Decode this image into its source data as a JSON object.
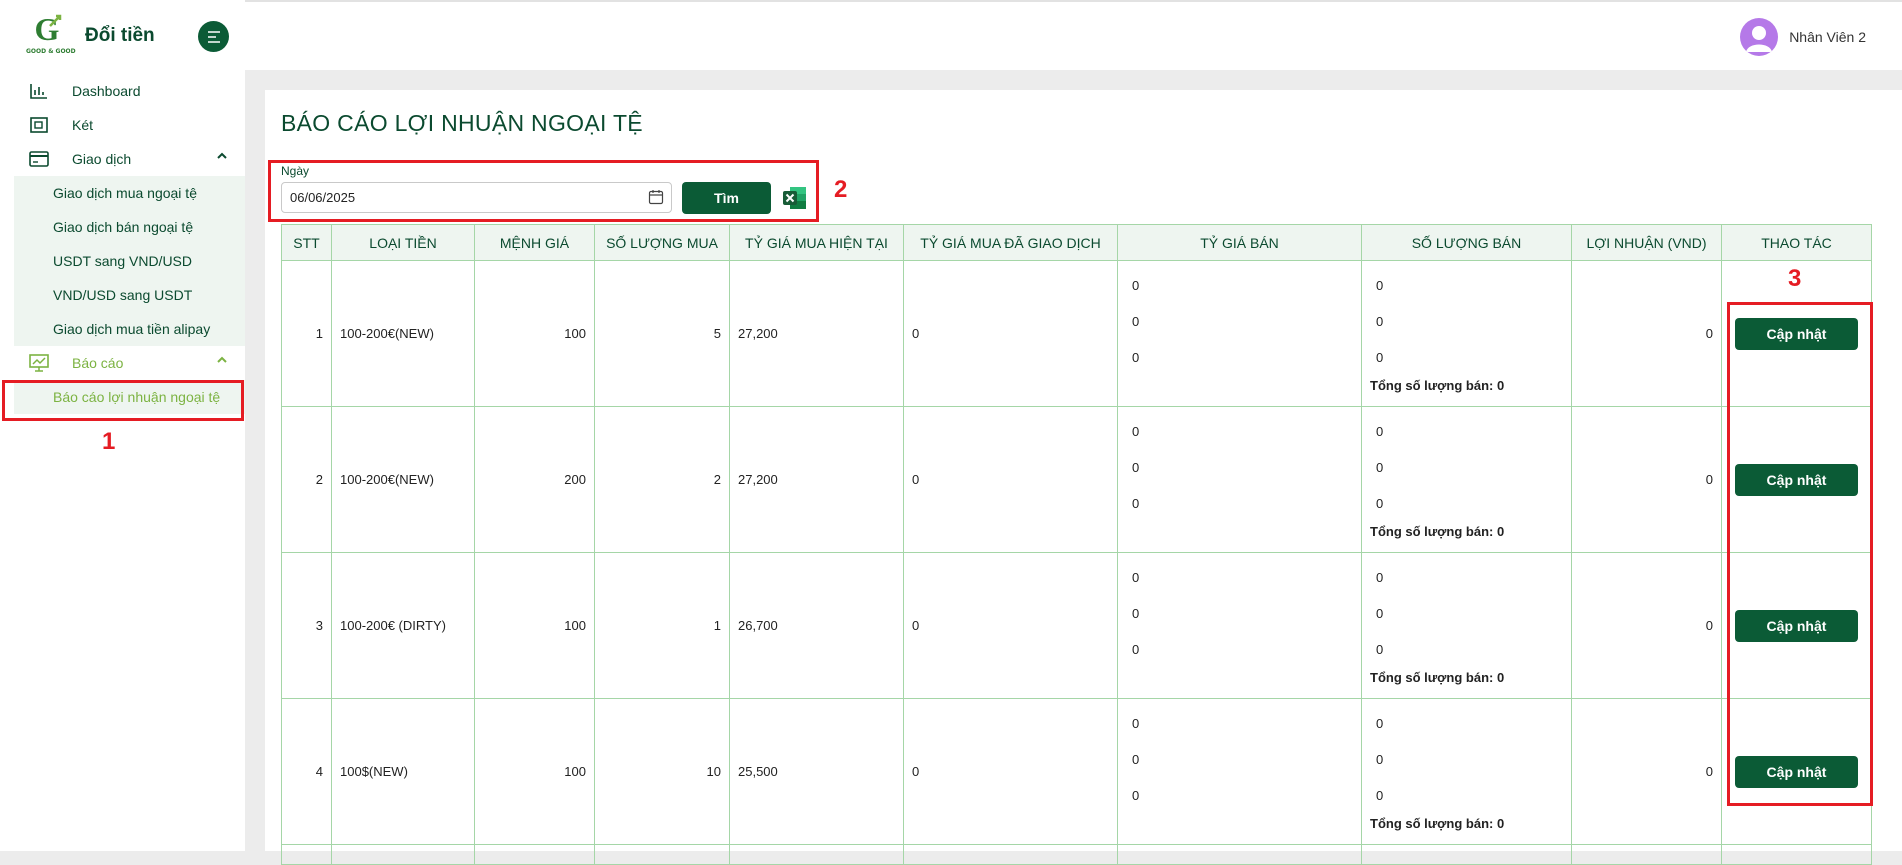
{
  "sidebar": {
    "brand_title": "Đổi tiền",
    "logo_text": "GOOD & GOOD",
    "items": [
      {
        "label": "Dashboard",
        "icon": "bar-chart-icon"
      },
      {
        "label": "Két",
        "icon": "safe-icon"
      },
      {
        "label": "Giao dịch",
        "icon": "card-icon",
        "expanded": true,
        "children": [
          "Giao dịch mua ngoại tệ",
          "Giao dịch bán ngoại tệ",
          "USDT sang VND/USD",
          "VND/USD sang USDT",
          "Giao dịch mua tiền alipay"
        ]
      },
      {
        "label": "Báo cáo",
        "icon": "presentation-chart-icon",
        "expanded": true,
        "children": [
          "Báo cáo lợi nhuận ngoại tệ"
        ]
      }
    ]
  },
  "header": {
    "user_name": "Nhân Viên 2"
  },
  "main": {
    "title": "BÁO CÁO LỢI NHUẬN NGOẠI TỆ",
    "date_label": "Ngày",
    "date_value": "06/06/2025",
    "search_label": "Tìm",
    "columns": [
      "STT",
      "LOẠI TIỀN",
      "MỆNH GIÁ",
      "SỐ LƯỢNG MUA",
      "TỶ GIÁ MUA HIỆN TẠI",
      "TỶ GIÁ MUA ĐÃ GIAO DỊCH",
      "TỶ GIÁ BÁN",
      "SỐ LƯỢNG BÁN",
      "LỢI NHUẬN (VND)",
      "THAO TÁC"
    ],
    "total_label": "Tổng số lượng bán: 0",
    "update_label": "Cập nhật",
    "rows": [
      {
        "stt": "1",
        "currency": "100-200€(NEW)",
        "denomination": "100",
        "qty": "5",
        "rate_now": "27,200",
        "rate_traded": "0",
        "sell_rates": [
          "0",
          "0",
          "0"
        ],
        "sell_qty": [
          "0",
          "0",
          "0"
        ],
        "profit": "0"
      },
      {
        "stt": "2",
        "currency": "100-200€(NEW)",
        "denomination": "200",
        "qty": "2",
        "rate_now": "27,200",
        "rate_traded": "0",
        "sell_rates": [
          "0",
          "0",
          "0"
        ],
        "sell_qty": [
          "0",
          "0",
          "0"
        ],
        "profit": "0"
      },
      {
        "stt": "3",
        "currency": "100-200€ (DIRTY)",
        "denomination": "100",
        "qty": "1",
        "rate_now": "26,700",
        "rate_traded": "0",
        "sell_rates": [
          "0",
          "0",
          "0"
        ],
        "sell_qty": [
          "0",
          "0",
          "0"
        ],
        "profit": "0"
      },
      {
        "stt": "4",
        "currency": "100$(NEW)",
        "denomination": "100",
        "qty": "10",
        "rate_now": "25,500",
        "rate_traded": "0",
        "sell_rates": [
          "0",
          "0",
          "0"
        ],
        "sell_qty": [
          "0",
          "0",
          "0"
        ],
        "profit": "0"
      }
    ]
  },
  "annotations": [
    "1",
    "2",
    "3"
  ],
  "colors": {
    "brand": "#0b5b36",
    "accent": "#7cb342",
    "annotation": "#e51c23"
  }
}
